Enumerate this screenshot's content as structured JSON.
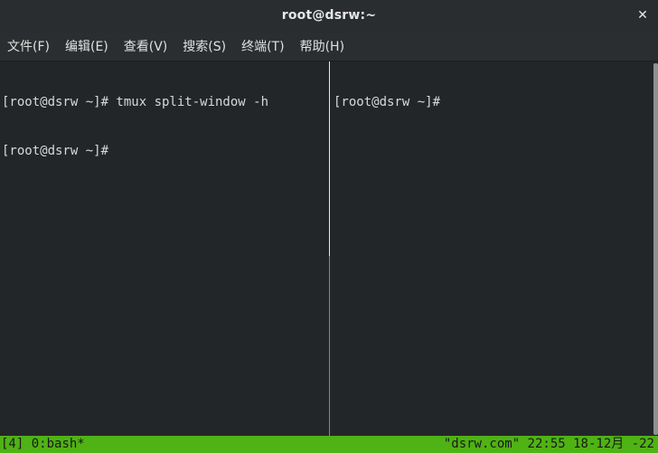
{
  "window": {
    "title": "root@dsrw:~",
    "close_icon": "✕"
  },
  "menu": {
    "items": [
      {
        "label": "文件(F)"
      },
      {
        "label": "编辑(E)"
      },
      {
        "label": "查看(V)"
      },
      {
        "label": "搜索(S)"
      },
      {
        "label": "终端(T)"
      },
      {
        "label": "帮助(H)"
      }
    ]
  },
  "left_pane": {
    "lines": [
      "[root@dsrw ~]# tmux split-window -h",
      "[root@dsrw ~]#"
    ]
  },
  "right_pane": {
    "lines": [
      "[root@dsrw ~]#"
    ]
  },
  "status": {
    "session": "[4]",
    "window": "0:bash*",
    "right": "\"dsrw.com\" 22:55 18-12月 -22"
  },
  "colors": {
    "terminal_bg": "#232629",
    "status_bg": "#4fb215",
    "active_divider": "#51b814"
  }
}
